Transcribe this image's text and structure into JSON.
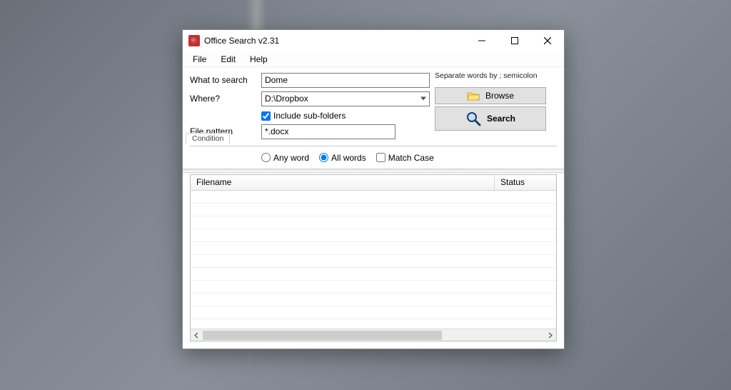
{
  "window": {
    "title": "Office Search v2.31"
  },
  "menu": {
    "file": "File",
    "edit": "Edit",
    "help": "Help"
  },
  "form": {
    "what_label": "What to search",
    "what_value": "Dome",
    "where_label": "Where?",
    "where_value": "D:\\Dropbox",
    "include_label": "Include sub-folders",
    "include_checked": true,
    "pattern_label": "File pattern",
    "pattern_value": "*.docx",
    "hint": "Separate words by ; semicolon",
    "browse_label": "Browse",
    "search_label": "Search",
    "condition_tab": "Condition",
    "any_word": "Any word",
    "all_words": "All words",
    "match_case": "Match Case",
    "selected_condition": "all"
  },
  "results": {
    "col_filename": "Filename",
    "col_status": "Status"
  }
}
